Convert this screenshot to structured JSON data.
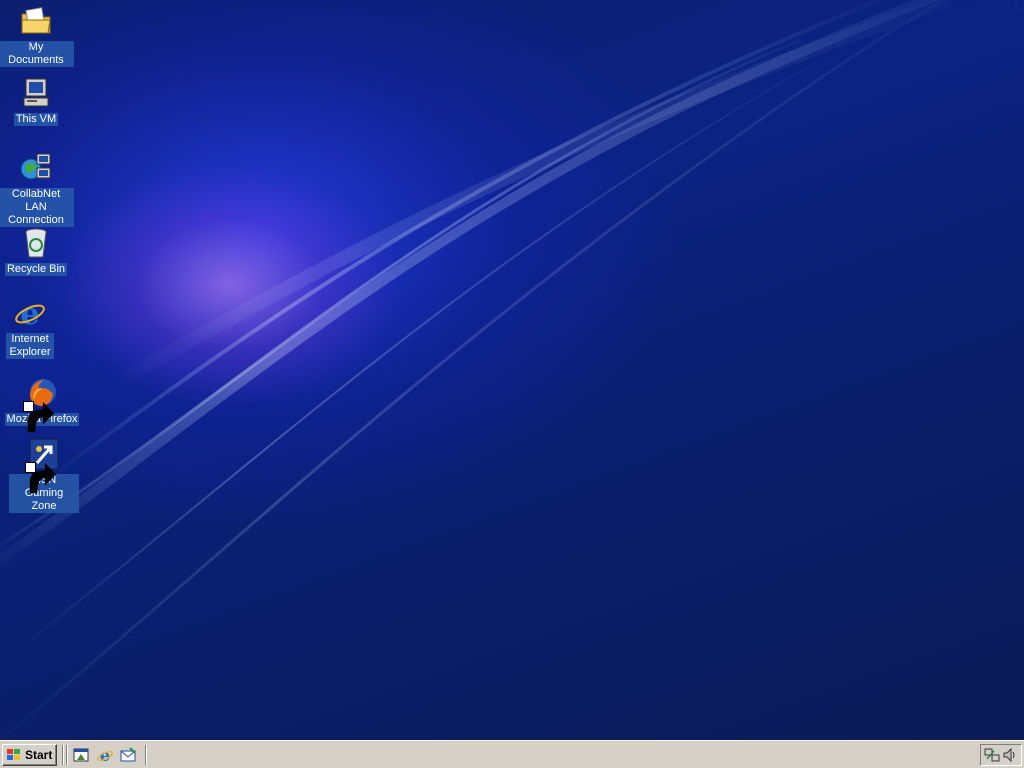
{
  "desktop": {
    "icons": [
      {
        "label": "My Documents",
        "icon": "folder-documents-icon"
      },
      {
        "label": "This VM",
        "icon": "computer-icon"
      },
      {
        "label": "CollabNet LAN Connection",
        "icon": "network-connection-icon"
      },
      {
        "label": "Recycle Bin",
        "icon": "recycle-bin-icon"
      },
      {
        "label": "Internet Explorer",
        "icon": "internet-explorer-icon"
      },
      {
        "label": "Mozilla Firefox",
        "icon": "firefox-icon",
        "shortcut": true
      },
      {
        "label": "MSN Gaming Zone",
        "icon": "msn-gaming-zone-icon",
        "shortcut": true
      }
    ]
  },
  "taskbar": {
    "start_label": "Start",
    "quick_launch": [
      "show-desktop-icon",
      "internet-explorer-icon",
      "outlook-express-icon"
    ],
    "tray": [
      "network-tray-icon",
      "volume-icon"
    ]
  },
  "colors": {
    "desktop_base": "#0c2383",
    "taskbar": "#d4d0c8",
    "icon_label_bg": "#285aaa"
  }
}
